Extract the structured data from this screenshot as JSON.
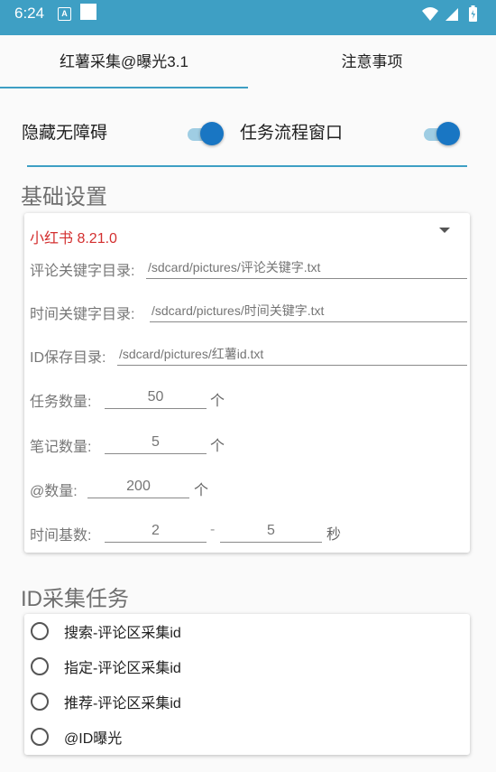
{
  "status_bar": {
    "time": "6:24",
    "notification_icon_text": "A"
  },
  "tabs": [
    {
      "label": "红薯采集@曝光3.1",
      "selected": true
    },
    {
      "label": "注意事项",
      "selected": false
    }
  ],
  "toggles": {
    "hide_accessibility": {
      "label": "隐藏无障碍",
      "on": true
    },
    "task_flow_window": {
      "label": "任务流程窗口",
      "on": true
    }
  },
  "basic_settings": {
    "title": "基础设置",
    "app_version_selected": "小红书 8.21.0",
    "comment_keyword_dir": {
      "label": "评论关键字目录:",
      "placeholder": "/sdcard/pictures/评论关键字.txt"
    },
    "time_keyword_dir": {
      "label": "时间关键字目录:",
      "placeholder": "/sdcard/pictures/时间关键字.txt"
    },
    "id_save_dir": {
      "label": "ID保存目录:",
      "placeholder": "/sdcard/pictures/红薯id.txt"
    },
    "task_count": {
      "label": "任务数量:",
      "placeholder": "50",
      "unit": "个"
    },
    "note_count": {
      "label": "笔记数量:",
      "placeholder": "5",
      "unit": "个"
    },
    "at_count": {
      "label": "@数量:",
      "placeholder": "200",
      "unit": "个"
    },
    "time_base": {
      "label": "时间基数:",
      "min_placeholder": "2",
      "separator": "-",
      "max_placeholder": "5",
      "unit": "秒"
    }
  },
  "id_tasks": {
    "title": "ID采集任务",
    "options": [
      {
        "label": "搜索-评论区采集id",
        "checked": false
      },
      {
        "label": "指定-评论区采集id",
        "checked": false
      },
      {
        "label": "推荐-评论区采集id",
        "checked": false
      },
      {
        "label": "@ID曝光",
        "checked": false
      }
    ]
  },
  "colors": {
    "accent": "#3e9fc4",
    "switch_thumb": "#1976c3",
    "spinner_text": "#d32f2f"
  }
}
